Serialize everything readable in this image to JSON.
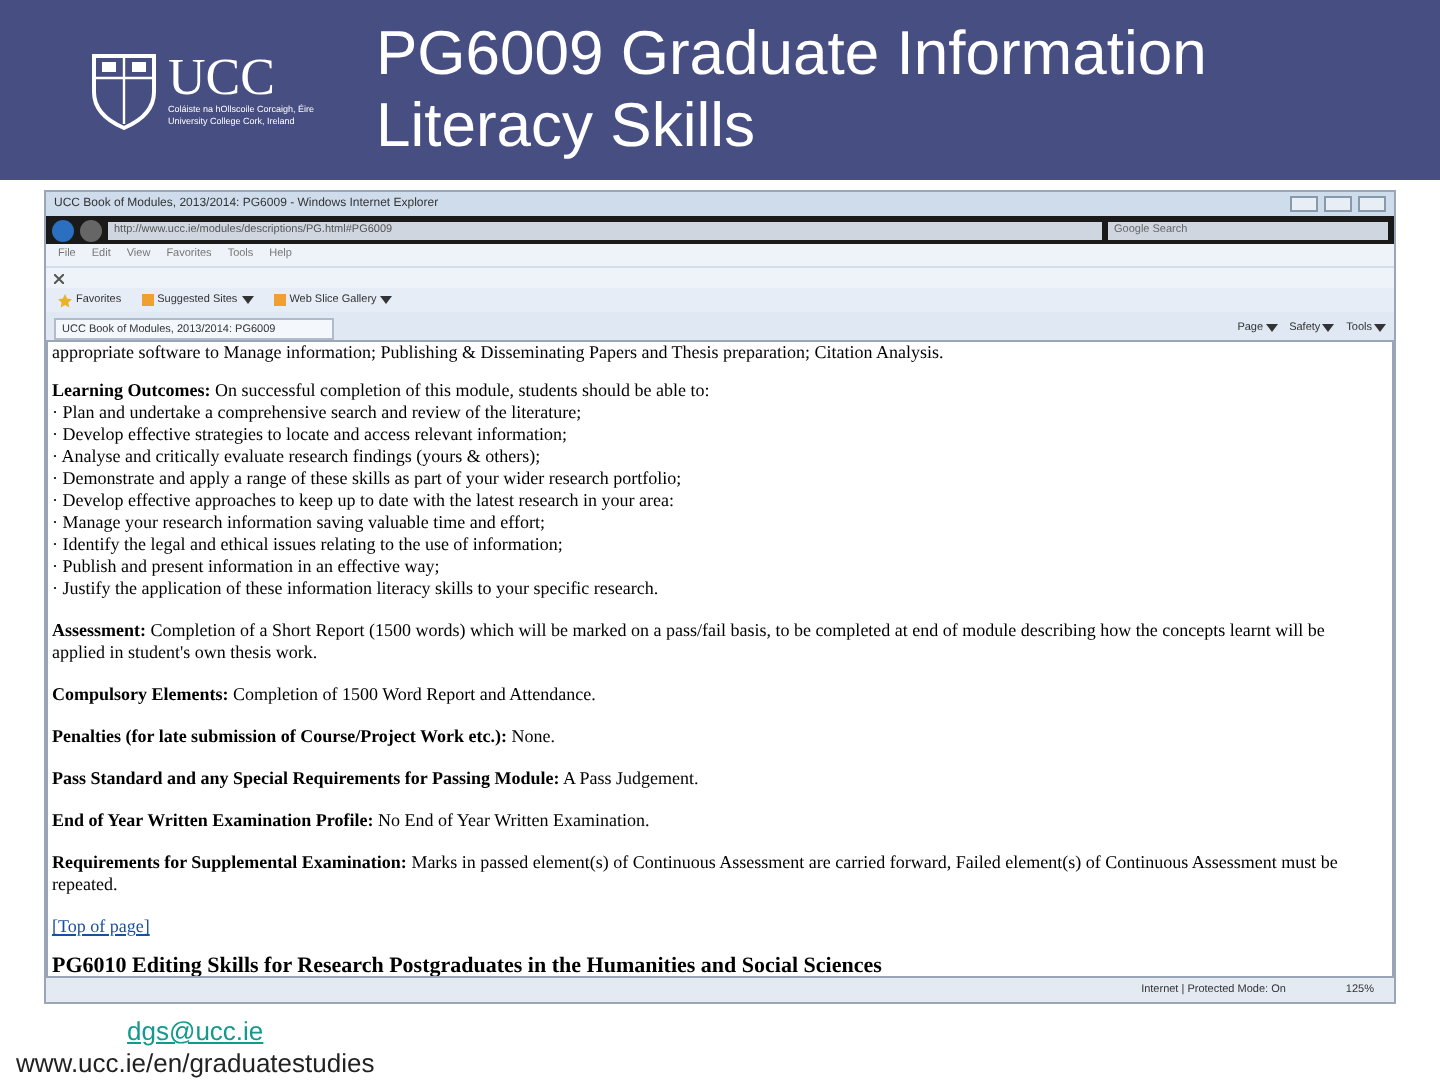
{
  "slide": {
    "title": "PG6009 Graduate Information Literacy Skills",
    "logo": {
      "wordmark": "UCC",
      "irish_name": "Coláiste na hOllscoile Corcaigh, Éire",
      "english_name": "University College Cork, Ireland"
    }
  },
  "browser": {
    "window_title": "UCC Book of Modules, 2013/2014: PG6009 - Windows Internet Explorer",
    "address": "http://www.ucc.ie/modules/descriptions/PG.html#PG6009",
    "search": {
      "placeholder": "Google Search"
    },
    "menu": [
      "File",
      "Edit",
      "View",
      "Favorites",
      "Tools",
      "Help"
    ],
    "favorites_bar": [
      {
        "label": "Favorites",
        "kind": "favorites"
      },
      {
        "label": "Suggested Sites",
        "kind": "dropdown"
      },
      {
        "label": "Web Slice Gallery",
        "kind": "dropdown"
      }
    ],
    "tab": {
      "label": "UCC Book of Modules, 2013/2014: PG6009"
    },
    "command_bar": [
      "Page",
      "Safety",
      "Tools"
    ],
    "content": {
      "cut_line": "appropriate software to Manage information; Publishing & Disseminating Papers and Thesis preparation; Citation Analysis.",
      "outcomes_intro": "**Learning Outcomes:** On successful completion of this module, students should be able to:",
      "outcomes": [
        "· Plan and undertake a comprehensive search and review of the literature;",
        "· Develop effective strategies to locate and access relevant information;",
        "· Analyse and critically evaluate research findings (yours & others);",
        "· Demonstrate and apply a range of these skills as part of your wider research portfolio;",
        "· Develop effective approaches to keep up to date with the latest research in your area:",
        "· Manage your research information saving valuable time and effort;",
        "· Identify the legal and ethical issues relating to the use of information;",
        "· Publish and present information in an effective way;",
        "· Justify the application of these information literacy skills to your specific research."
      ],
      "paragraphs": [
        "**Assessment:** Completion of a Short Report (1500 words) which will be marked on a pass/fail basis, to be completed at end of module describing how the concepts learnt will be applied in student's own thesis work.",
        "**Compulsory Elements:** Completion of 1500 Word Report and Attendance.",
        "**Penalties (for late submission of Course/Project Work etc.):** None.",
        "**Pass Standard and any Special Requirements for Passing Module:** A Pass Judgement.",
        "**End of Year Written Examination Profile:** No End of Year Written Examination.",
        "**Requirements for Supplemental Examination:** Marks in passed element(s) of Continuous Assessment are carried forward, Failed element(s) of Continuous Assessment must be repeated."
      ],
      "top_link": "[Top of page]",
      "next_heading": "PG6010 Editing Skills for Research Postgraduates in the Humanities and Social Sciences"
    },
    "status_bar": {
      "zone": "Internet | Protected Mode: On",
      "zoom": "125%"
    }
  },
  "footer": {
    "email": "dgs@ucc.ie",
    "url": "www.ucc.ie/en/graduatestudies"
  }
}
